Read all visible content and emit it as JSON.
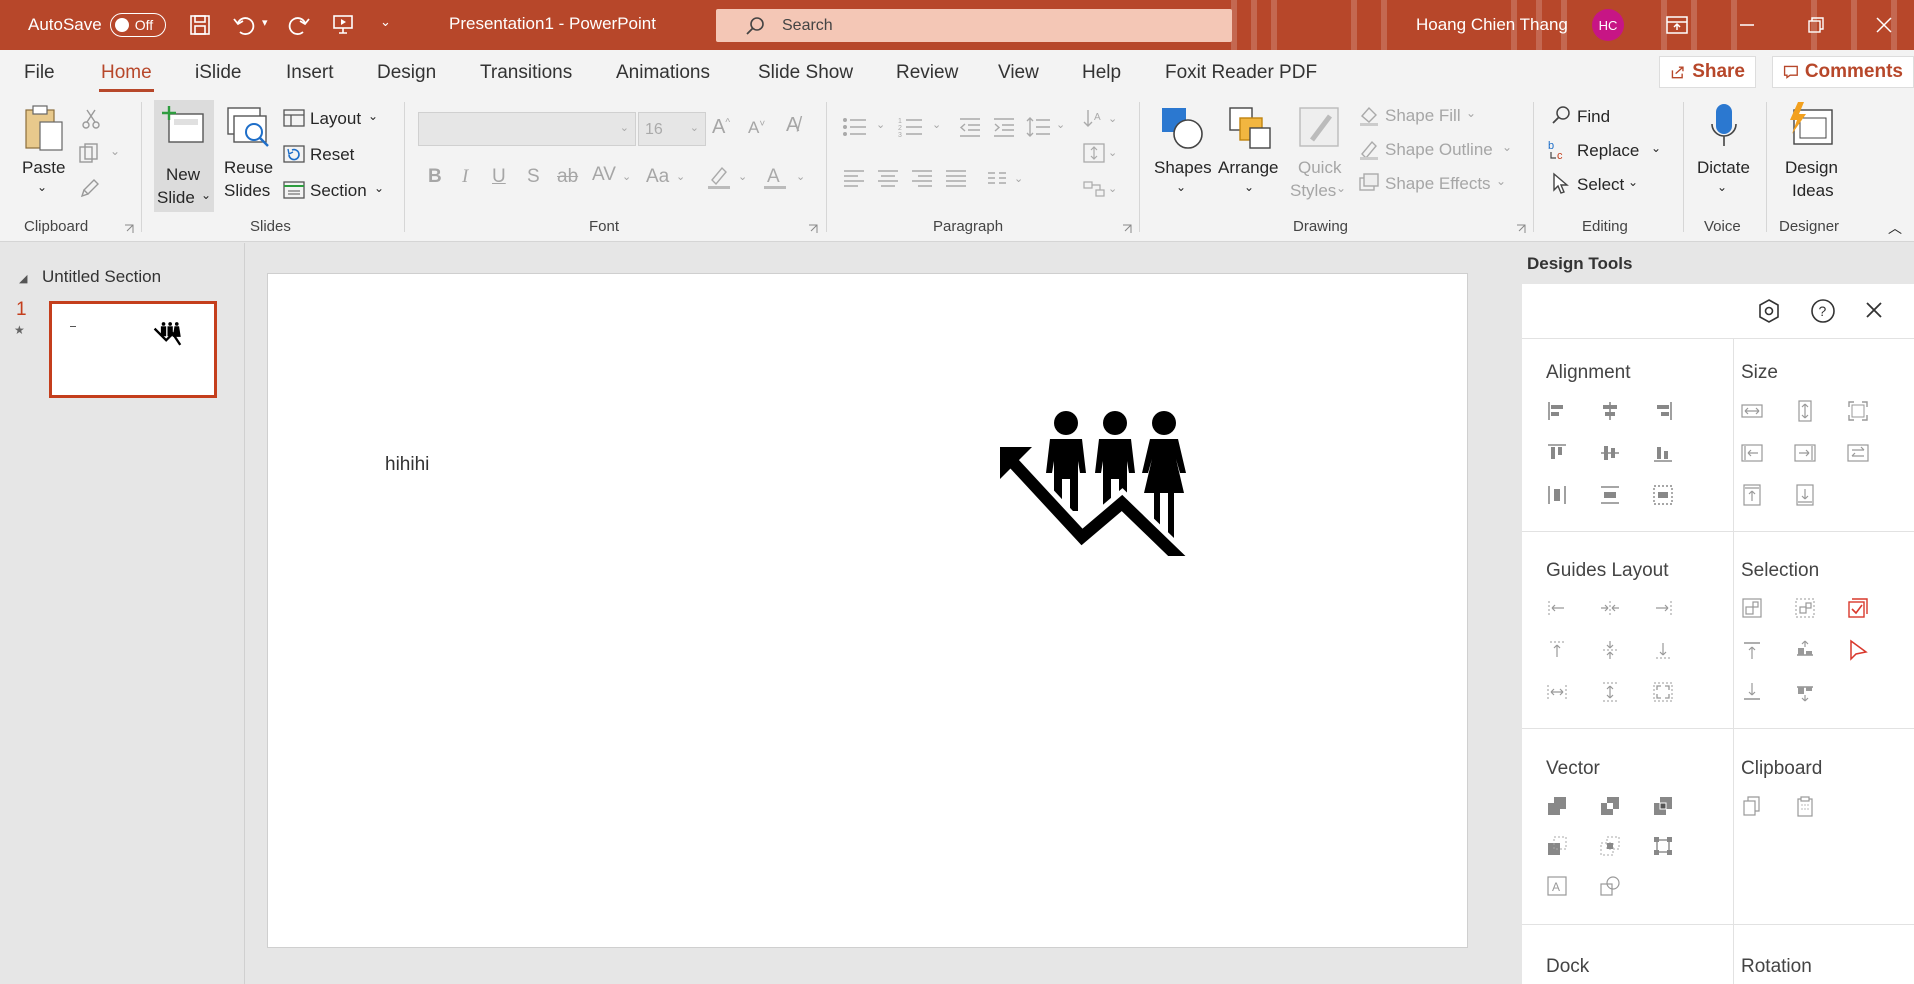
{
  "titlebar": {
    "autosave_label": "AutoSave",
    "autosave_state": "Off",
    "doc_title": "Presentation1  -  PowerPoint",
    "search_placeholder": "Search",
    "user_name": "Hoang Chien Thang",
    "user_initials": "HC",
    "accent": "#b7472a"
  },
  "tabs": [
    {
      "label": "File"
    },
    {
      "label": "Home"
    },
    {
      "label": "iSlide"
    },
    {
      "label": "Insert"
    },
    {
      "label": "Design"
    },
    {
      "label": "Transitions"
    },
    {
      "label": "Animations"
    },
    {
      "label": "Slide Show"
    },
    {
      "label": "Review"
    },
    {
      "label": "View"
    },
    {
      "label": "Help"
    },
    {
      "label": "Foxit Reader PDF"
    }
  ],
  "share_label": "Share",
  "comments_label": "Comments",
  "ribbon": {
    "clipboard": {
      "paste": "Paste",
      "group": "Clipboard"
    },
    "slides": {
      "new_slide_1": "New",
      "new_slide_2": "Slide",
      "reuse_1": "Reuse",
      "reuse_2": "Slides",
      "layout": "Layout",
      "reset": "Reset",
      "section": "Section",
      "group": "Slides"
    },
    "font": {
      "font_size": "16",
      "group": "Font"
    },
    "paragraph": {
      "group": "Paragraph"
    },
    "drawing": {
      "shapes": "Shapes",
      "arrange": "Arrange",
      "quick_1": "Quick",
      "quick_2": "Styles",
      "shape_fill": "Shape Fill",
      "shape_outline": "Shape Outline",
      "shape_effects": "Shape Effects",
      "group": "Drawing"
    },
    "editing": {
      "find": "Find",
      "replace": "Replace",
      "select": "Select",
      "group": "Editing"
    },
    "voice": {
      "dictate": "Dictate",
      "group": "Voice"
    },
    "designer": {
      "ideas_1": "Design",
      "ideas_2": "Ideas",
      "group": "Designer"
    }
  },
  "thumbnails": {
    "section_title": "Untitled Section",
    "slide_number": "1"
  },
  "slide": {
    "text": "hihihi"
  },
  "design_tools": {
    "title": "Design Tools",
    "sections": {
      "alignment": "Alignment",
      "size": "Size",
      "guides_layout": "Guides Layout",
      "selection": "Selection",
      "vector": "Vector",
      "clipboard": "Clipboard",
      "dock": "Dock",
      "rotation": "Rotation"
    }
  }
}
